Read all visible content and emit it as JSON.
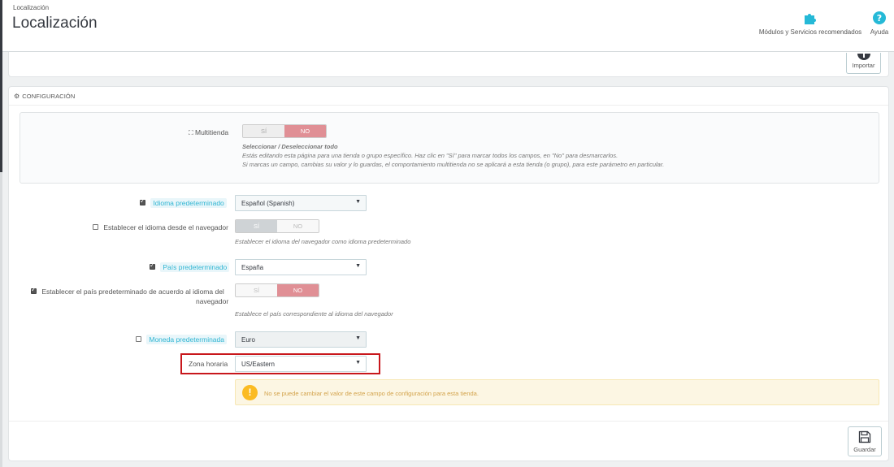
{
  "header": {
    "breadcrumb": "Localización",
    "title": "Localización",
    "modules_label": "Módulos y Servicios recomendados",
    "help_label": "Ayuda"
  },
  "import": {
    "label": "Importar"
  },
  "config": {
    "heading": "Configuración",
    "multishop": {
      "label": "Multitienda",
      "yes": "SÍ",
      "no": "NO",
      "help_title": "Seleccionar / Deseleccionar todo",
      "help_line1": "Estás editando esta página para una tienda o grupo específico. Haz clic en \"Sí\" para marcar todos los campos, en \"No\" para desmarcarlos.",
      "help_line2": "Si marcas un campo, cambias su valor y lo guardas, el comportamiento multitienda no se aplicará a esta tienda (o grupo), para este parámetro en particular."
    },
    "default_language": {
      "label": "Idioma predeterminado",
      "value": "Español (Spanish)"
    },
    "browser_language": {
      "label": "Establecer el idioma desde el navegador",
      "yes": "SÍ",
      "no": "NO",
      "help": "Establecer el idioma del navegador como idioma predeterminado"
    },
    "default_country": {
      "label": "País predeterminado",
      "value": "España"
    },
    "country_by_language": {
      "label_line1": "Establecer el país predeterminado de acuerdo al idioma del",
      "label_line2": "navegador",
      "yes": "SÍ",
      "no": "NO",
      "help": "Establece el país correspondiente al idioma del navegador"
    },
    "default_currency": {
      "label": "Moneda predeterminada",
      "value": "Euro"
    },
    "timezone": {
      "label": "Zona horaria",
      "value": "US/Eastern"
    },
    "alert": "No se puede cambiar el valor de este campo de configuración para esta tienda.",
    "save_label": "Guardar"
  },
  "colors": {
    "accent": "#2fb5d2",
    "switch_no": "#e08f95",
    "warning": "#fbbb22",
    "highlight": "#c8171c"
  }
}
